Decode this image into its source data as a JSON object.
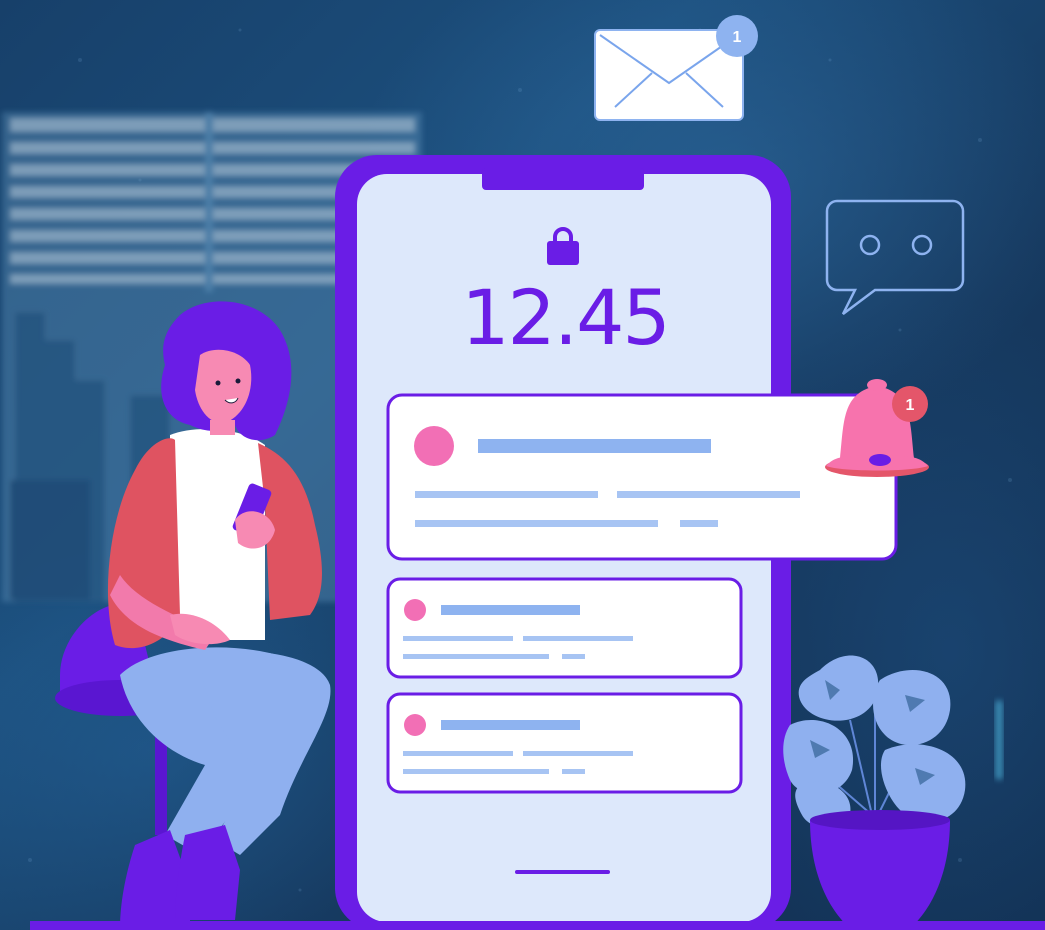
{
  "lock_screen": {
    "time": "12.45",
    "lock_icon": "lock-icon"
  },
  "badges": {
    "mail_count": "1",
    "bell_count": "1"
  },
  "icons": [
    "mail-icon",
    "chat-bubble-icon",
    "bell-icon",
    "lock-icon"
  ],
  "colors": {
    "background": "#1c4f7d",
    "phone_frame": "#6a1de6",
    "screen": "#dde8fb",
    "accent_pink": "#f26fb5",
    "placeholder_blue": "#8eb3f0",
    "badge": "#e4566a",
    "bell": "#f773ad",
    "plant": "#8fb0ef"
  }
}
